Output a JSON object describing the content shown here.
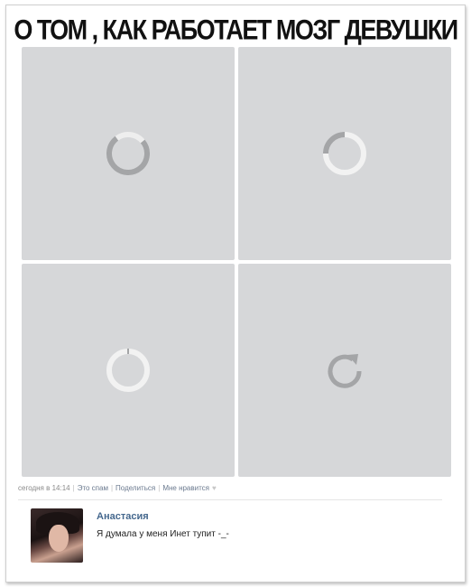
{
  "title": "О ТОМ , КАК РАБОТАЕТ МОЗГ ДЕВУШКИ",
  "tiles": [
    {
      "icon": "loading-ring-icon"
    },
    {
      "icon": "loading-ring-icon"
    },
    {
      "icon": "loading-ring-icon"
    },
    {
      "icon": "refresh-icon"
    }
  ],
  "post_meta": {
    "time": "сегодня в 14:14",
    "spam": "Это спам",
    "share": "Поделиться",
    "like": "Мне нравится"
  },
  "comment": {
    "author": "Анастасия",
    "text": "Я думала у меня Инет тупит -_-"
  },
  "colors": {
    "tile_bg": "#d6d7d9",
    "icon_gray": "#a4a5a7",
    "icon_white": "#f2f2f2",
    "author_link": "#45688e"
  }
}
